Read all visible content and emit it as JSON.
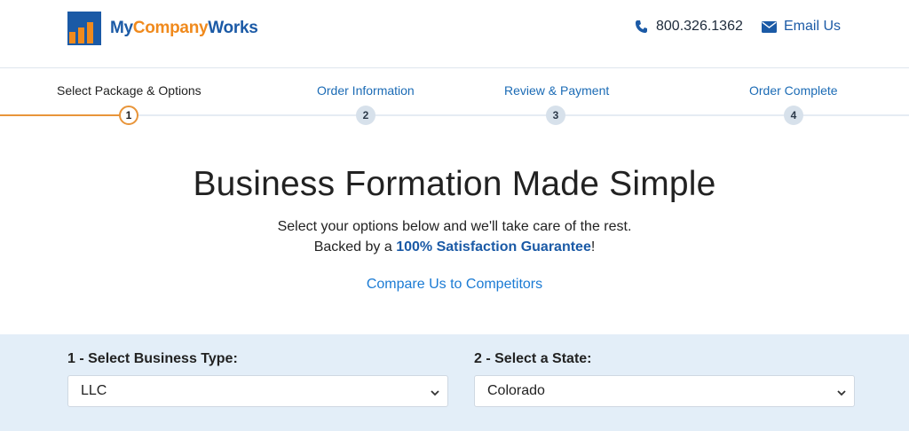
{
  "brand": {
    "name_part1": "My",
    "name_part2": "Company",
    "name_part3": "Works",
    "colors": {
      "primary": "#1b5aa6",
      "accent": "#f08a1d"
    }
  },
  "header": {
    "phone": "800.326.1362",
    "phone_icon": "phone-icon",
    "email_label": "Email Us",
    "email_icon": "envelope-icon"
  },
  "stepper": {
    "steps": [
      {
        "label": "Select Package & Options",
        "number": "1",
        "state": "active"
      },
      {
        "label": "Order Information",
        "number": "2",
        "state": "todo"
      },
      {
        "label": "Review & Payment",
        "number": "3",
        "state": "todo"
      },
      {
        "label": "Order Complete",
        "number": "4",
        "state": "todo"
      }
    ],
    "colors": {
      "active": "#e8953a",
      "inactive": "#d7e1eb"
    }
  },
  "hero": {
    "title": "Business Formation Made Simple",
    "subtitle_line1": "Select your options below and we'll take care of the rest.",
    "subtitle_line2_prefix": "Backed by a ",
    "subtitle_guarantee": "100% Satisfaction Guarantee",
    "subtitle_line2_suffix": "!",
    "compare_link": "Compare Us to Competitors"
  },
  "form": {
    "business_type": {
      "label": "1 - Select Business Type:",
      "value": "LLC"
    },
    "state": {
      "label": "2 - Select a State:",
      "value": "Colorado"
    }
  }
}
